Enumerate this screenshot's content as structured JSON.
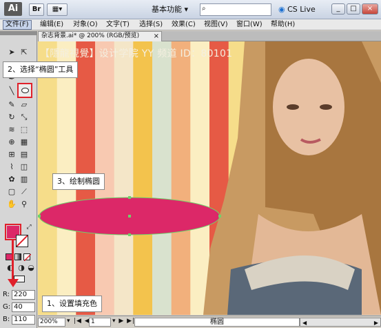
{
  "titlebar": {
    "logo": "Ai",
    "br_icon": "Br",
    "workspace": "基本功能 ▾",
    "cslive": "CS Live ▾"
  },
  "menu": {
    "items": [
      "文件(F)",
      "编辑(E)",
      "对象(O)",
      "文字(T)",
      "选择(S)",
      "效果(C)",
      "视图(V)",
      "窗口(W)",
      "帮助(H)"
    ]
  },
  "document": {
    "tab": "杂志背景.ai* @ 200% (RGB/预览)",
    "close": "×"
  },
  "watermark": "【隱龍視覺】设计学院  YY 频道 ID：80101",
  "annotations": {
    "step2": "2、选择“椭圆”工具",
    "step3": "3、绘制椭圆",
    "step1": "1、设置填充色"
  },
  "color": {
    "fill": "#dc2868",
    "accent_red": "#e0202a",
    "r_label": "R:",
    "g_label": "G:",
    "b_label": "B:",
    "r": "220",
    "g": "40",
    "b": "110"
  },
  "status": {
    "zoom": "200%",
    "page": "1",
    "tool": "椭圆"
  },
  "stripes": [
    "#f6dd8a",
    "#fbeec2",
    "#e65a45",
    "#f8c9b1",
    "#f4e6c8",
    "#f3c34d",
    "#d9e2ce",
    "#f2b07c",
    "#fbeec2",
    "#e65a45",
    "#f6dd8a",
    "#c1dcd0",
    "#f3c34d",
    "#e65a45",
    "#fbeec2",
    "#f6dd8a",
    "#e65a45",
    "#f8c9b1"
  ]
}
